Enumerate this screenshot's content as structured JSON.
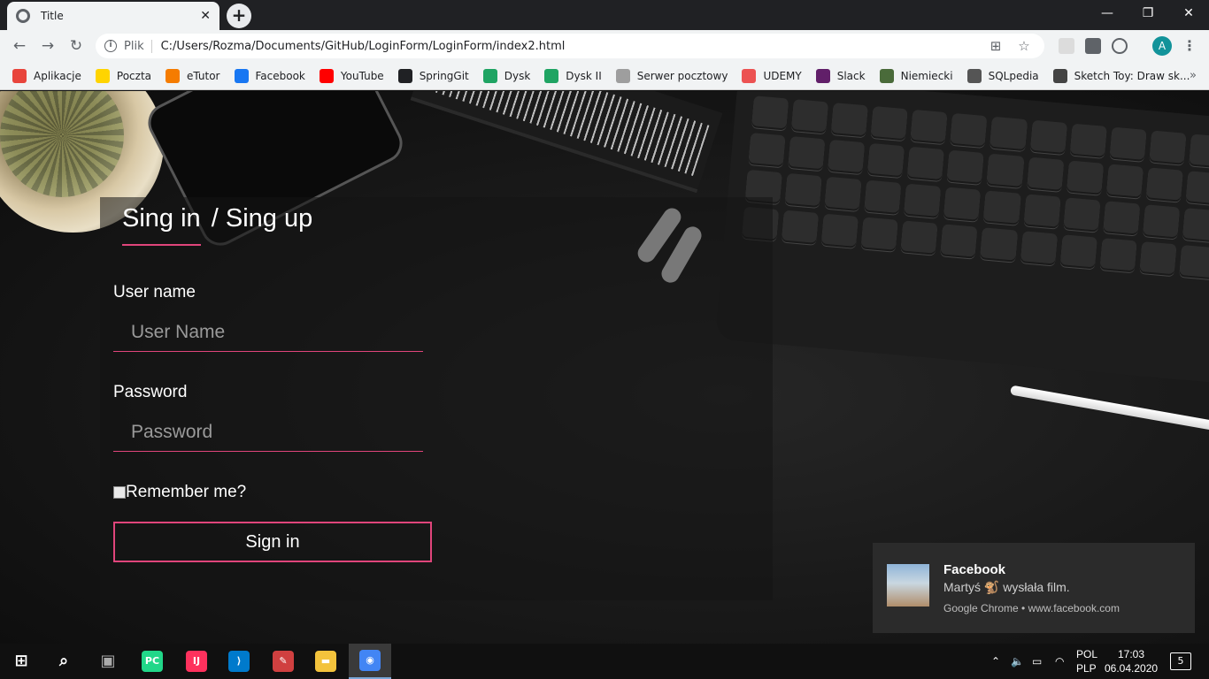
{
  "browser": {
    "tab_title": "Title",
    "tab_close": "✕",
    "new_tab": "+",
    "scheme_label": "Plik",
    "url": "C:/Users/Rozma/Documents/GitHub/LoginForm/LoginForm/index2.html",
    "avatar_letter": "A"
  },
  "bookmarks": [
    {
      "label": "Aplikacje",
      "icon": "apps-grid-icon",
      "color": "#e8453c"
    },
    {
      "label": "Poczta",
      "icon": "mail-icon",
      "color": "#ffd400"
    },
    {
      "label": "eTutor",
      "icon": "etutor-icon",
      "color": "#f57c00"
    },
    {
      "label": "Facebook",
      "icon": "facebook-icon",
      "color": "#1877f2"
    },
    {
      "label": "YouTube",
      "icon": "youtube-icon",
      "color": "#ff0000"
    },
    {
      "label": "SpringGit",
      "icon": "github-icon",
      "color": "#202124"
    },
    {
      "label": "Dysk",
      "icon": "drive-icon",
      "color": "#1fa463"
    },
    {
      "label": "Dysk II",
      "icon": "drive-icon",
      "color": "#1fa463"
    },
    {
      "label": "Serwer pocztowy",
      "icon": "mail-server-icon",
      "color": "#9e9e9e"
    },
    {
      "label": "UDEMY",
      "icon": "udemy-icon",
      "color": "#ec5252"
    },
    {
      "label": "Slack",
      "icon": "slack-icon",
      "color": "#611f69"
    },
    {
      "label": "Niemiecki",
      "icon": "niemiecki-icon",
      "color": "#4a6b3a"
    },
    {
      "label": "SQLpedia",
      "icon": "sqlpedia-icon",
      "color": "#555555"
    },
    {
      "label": "Sketch Toy: Draw sk...",
      "icon": "sketch-icon",
      "color": "#444444"
    }
  ],
  "bookmarks_more": "»",
  "login": {
    "tab_signin": "Sing in",
    "tab_signup": "/ Sing up",
    "username_label": "User name",
    "username_placeholder": "User Name",
    "password_label": "Password",
    "password_placeholder": "Password",
    "remember_label": "Remember me?",
    "remember_checked": false,
    "submit_label": "Sign in",
    "accent_color": "#e0457b"
  },
  "notification": {
    "title": "Facebook",
    "body": "Martyś 🐒 wysłała film.",
    "attribution": "Google Chrome • www.facebook.com"
  },
  "taskbar": {
    "items": [
      {
        "icon": "windows-start-icon",
        "color": "#ffffff"
      },
      {
        "icon": "search-icon",
        "color": "#ffffff"
      },
      {
        "icon": "task-view-icon",
        "color": "#aaaaaa"
      },
      {
        "icon": "pycharm-icon",
        "color": "#21d789"
      },
      {
        "icon": "intellij-icon",
        "color": "#fe315d"
      },
      {
        "icon": "vscode-icon",
        "color": "#007acc"
      },
      {
        "icon": "paint-icon",
        "color": "#d04040"
      },
      {
        "icon": "file-explorer-icon",
        "color": "#f3c33c"
      },
      {
        "icon": "chrome-icon",
        "color": "#4285f4"
      }
    ],
    "lang_top": "POL",
    "lang_bottom": "PLP",
    "time": "17:03",
    "date": "06.04.2020",
    "notifications_count": "5"
  }
}
